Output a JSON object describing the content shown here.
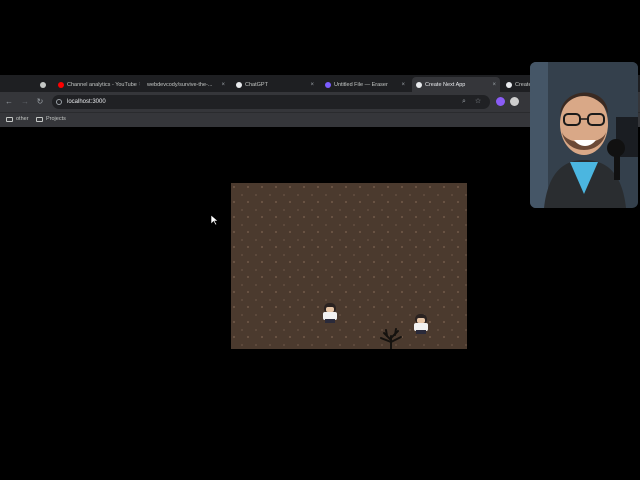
{
  "browser": {
    "tabs": [
      {
        "label": "",
        "favicon_color": "#c4c7c5"
      },
      {
        "label": "Channel analytics - YouTube",
        "favicon_color": "#ff0000"
      },
      {
        "label": "webdevcody/survive-the-...",
        "favicon_color": "#c4c7c5"
      },
      {
        "label": "ChatGPT",
        "favicon_color": "#e8eaed"
      },
      {
        "label": "Untitled File — Eraser",
        "favicon_color": "#7b5cff"
      },
      {
        "label": "Create Next App",
        "favicon_color": "#e8eaed",
        "active": true
      },
      {
        "label": "Create",
        "favicon_color": "#e8eaed"
      }
    ],
    "url": "localhost:3000",
    "bookmarks": [
      "other",
      "Projects"
    ],
    "icons": {
      "back": "arrow-left-icon",
      "forward": "arrow-right-icon",
      "reload": "reload-icon",
      "zoom": "magnifier-icon",
      "star": "star-icon"
    }
  },
  "game": {
    "background_color": "#4b3a2e"
  },
  "webcam": {
    "description_label": ""
  }
}
